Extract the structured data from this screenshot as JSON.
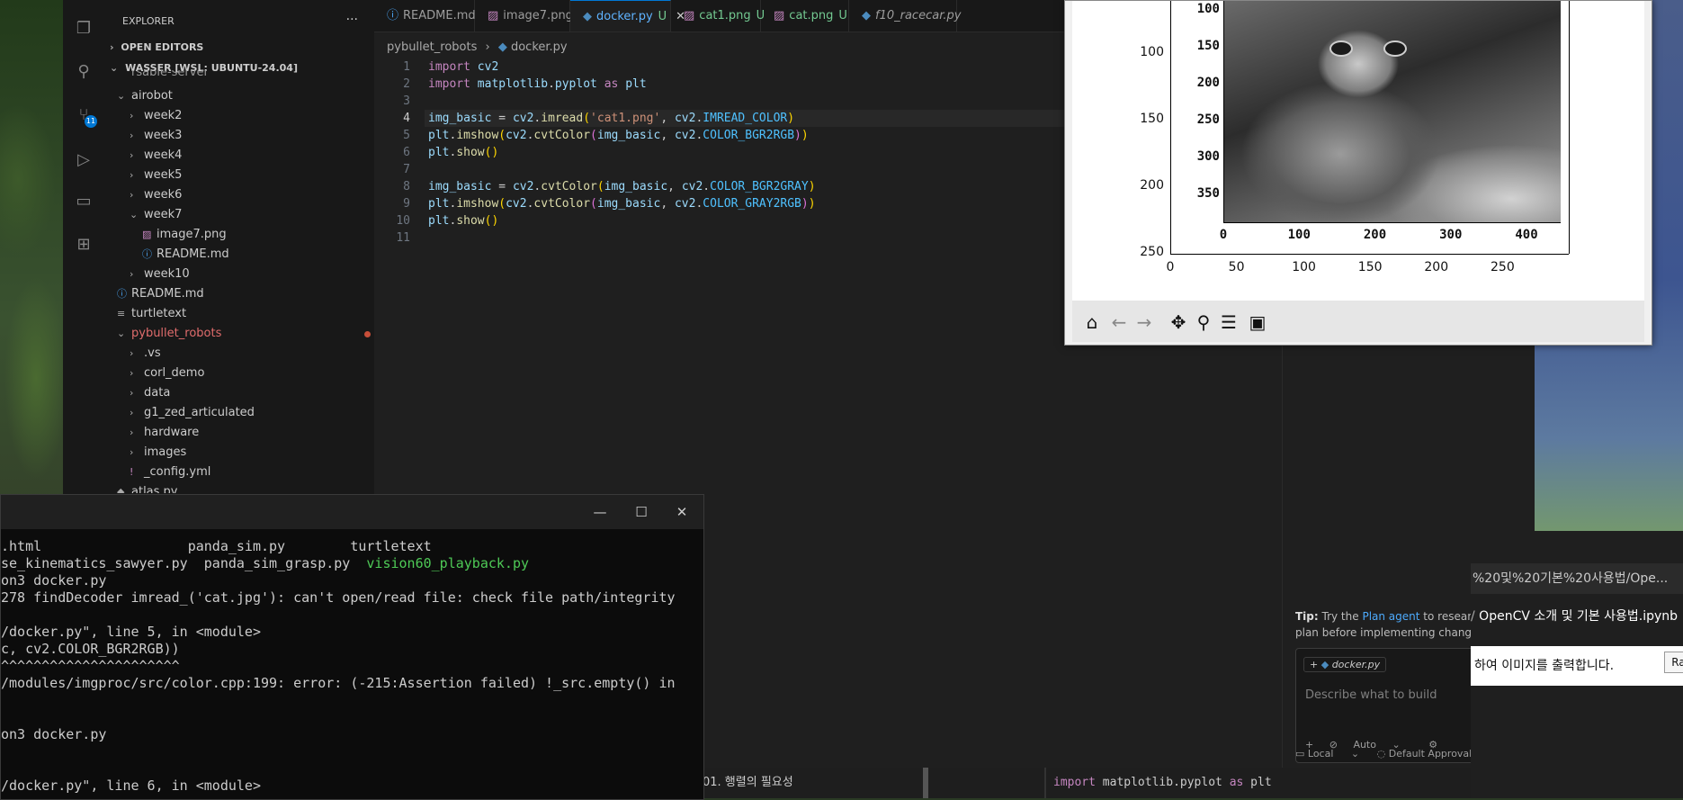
{
  "explorer": {
    "title": "EXPLORER",
    "more": "···",
    "open_editors": "OPEN EDITORS",
    "workspace": "WASSER [WSL: UBUNTU-24.04]",
    "truncated_item": "rsable-server",
    "items": [
      {
        "label": "airobot",
        "chev": "⌄"
      },
      {
        "label": "week2",
        "chev": "›"
      },
      {
        "label": "week3",
        "chev": "›"
      },
      {
        "label": "week4",
        "chev": "›"
      },
      {
        "label": "week5",
        "chev": "›"
      },
      {
        "label": "week6",
        "chev": "›"
      },
      {
        "label": "week7",
        "chev": "⌄"
      },
      {
        "label": "image7.png",
        "chev": ""
      },
      {
        "label": "README.md",
        "chev": ""
      },
      {
        "label": "week10",
        "chev": "›"
      },
      {
        "label": "README.md",
        "chev": ""
      },
      {
        "label": "turtletext",
        "chev": ""
      },
      {
        "label": "pybullet_robots",
        "chev": "⌄"
      },
      {
        "label": ".vs",
        "chev": "›"
      },
      {
        "label": "corl_demo",
        "chev": "›"
      },
      {
        "label": "data",
        "chev": "›"
      },
      {
        "label": "g1_zed_articulated",
        "chev": "›"
      },
      {
        "label": "hardware",
        "chev": "›"
      },
      {
        "label": "images",
        "chev": "›"
      },
      {
        "label": "_config.yml",
        "chev": "!"
      },
      {
        "label": "atlas.py",
        "chev": ""
      }
    ]
  },
  "activity_badge": "11",
  "tabs": [
    {
      "label": "README.md",
      "icon": "ⓘ",
      "modified": ""
    },
    {
      "label": "image7.png",
      "icon": "▨",
      "modified": ""
    },
    {
      "label": "docker.py",
      "icon": "◆",
      "modified": "U"
    },
    {
      "label": "cat1.png",
      "icon": "▨",
      "modified": "U"
    },
    {
      "label": "cat.png",
      "icon": "▨",
      "modified": "U"
    },
    {
      "label": "f10_racecar.py",
      "icon": "◆",
      "modified": ""
    }
  ],
  "breadcrumb": {
    "folder": "pybullet_robots",
    "separator": "›",
    "file": "docker.py"
  },
  "code": {
    "line_numbers": [
      "1",
      "2",
      "3",
      "4",
      "5",
      "6",
      "7",
      "8",
      "9",
      "10",
      "11"
    ],
    "current_line": 4
  },
  "figure": {
    "x_ticks_outer": [
      "0",
      "50",
      "100",
      "150",
      "200",
      "250"
    ],
    "y_ticks_outer": [
      "100",
      "150",
      "200",
      "250"
    ],
    "x_ticks_inner": [
      "0",
      "100",
      "200",
      "300",
      "400"
    ],
    "y_ticks_inner": [
      "100",
      "150",
      "200",
      "250",
      "300",
      "350"
    ],
    "toolbar": [
      "home-icon",
      "back-icon",
      "forward-icon",
      "pan-icon",
      "zoom-icon",
      "configure-icon",
      "save-icon"
    ]
  },
  "chat": {
    "tip_label": "Tip:",
    "tip_pre": "Try the",
    "tip_link": "Plan agent",
    "tip_post": "to research and plan before implementing changes.",
    "context_chip": "docker.py",
    "placeholder": "Describe what to build",
    "mode": "Auto",
    "local": "Local",
    "approvals": "Default Approvals"
  },
  "terminal": {
    "lines": [
      {
        "parts": [
          ".html                  ",
          "panda_sim.py        ",
          "turtletext"
        ]
      },
      {
        "parts": [
          "se_kinematics_sawyer.py  ",
          "panda_sim_grasp.py  "
        ],
        "green": "vision60_playback.py"
      },
      {
        "parts": [
          "on3 docker.py"
        ]
      },
      {
        "parts": [
          "278 findDecoder imread_('cat.jpg'): can't open/read file: check file path/integrity"
        ]
      },
      {
        "parts": [
          ""
        ]
      },
      {
        "parts": [
          "/docker.py\", line 5, in <module>"
        ]
      },
      {
        "parts": [
          "c, cv2.COLOR_BGR2RGB))"
        ]
      },
      {
        "parts": [
          "^^^^^^^^^^^^^^^^^^^^^^"
        ]
      },
      {
        "parts": [
          "/modules/imgproc/src/color.cpp:199: error: (-215:Assertion failed) !_src.empty() in"
        ]
      },
      {
        "parts": [
          ""
        ]
      },
      {
        "parts": [
          ""
        ]
      },
      {
        "parts": [
          "on3 docker.py"
        ]
      },
      {
        "parts": [
          ""
        ]
      },
      {
        "parts": [
          ""
        ]
      },
      {
        "parts": [
          "/docker.py\", line 6, in <module>"
        ]
      }
    ]
  },
  "browser": {
    "url": "%20및%20기본%20사용법/Ope...",
    "title": "OpenCV 소개 및 기본 사용법.ipynb",
    "body": "하여 이미지를 출력합니다.",
    "button": "Ra"
  },
  "notebook": {
    "left_text": "01. 행렬의 필요성",
    "code_import": "import",
    "code_module": "matplotlib.pyplot",
    "code_as": "as",
    "code_alias": "plt"
  }
}
